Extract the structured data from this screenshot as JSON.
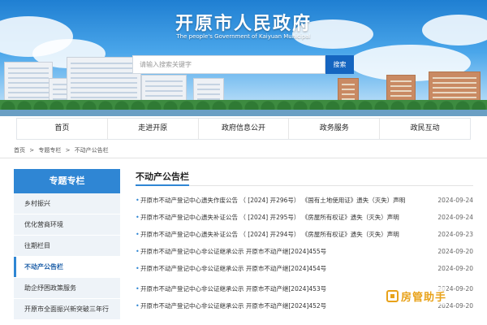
{
  "header": {
    "site_title": "开原市人民政府",
    "site_subtitle": "The people's Government of Kaiyuan Municipal",
    "search_placeholder": "请输入搜索关键字",
    "search_button": "搜索"
  },
  "nav": [
    "首页",
    "走进开原",
    "政府信息公开",
    "政务服务",
    "政民互动"
  ],
  "breadcrumb": [
    "首页",
    ">",
    "专题专栏",
    ">",
    "不动产公告栏"
  ],
  "sidebar": {
    "title": "专题专栏",
    "items": [
      "乡村振兴",
      "优化营商环境",
      "往期栏目",
      "不动产公告栏",
      "助企纾困政策服务",
      "开原市全面振兴新突破三年行"
    ],
    "active_index": 3
  },
  "main": {
    "title": "不动产公告栏",
    "items": [
      {
        "title": "开原市不动产登记中心遗失作废公告  （ [2024] 开296号） 《国有土地使用证》遗失（灭失）声明",
        "date": "2024-09-24"
      },
      {
        "title": "开原市不动产登记中心遗失补证公告  （ [2024] 开295号） 《房屋所有权证》遗失（灭失）声明",
        "date": "2024-09-24"
      },
      {
        "title": "开原市不动产登记中心遗失补证公告  （ [2024] 开294号） 《房屋所有权证》遗失（灭失）声明",
        "date": "2024-09-23"
      },
      {
        "title": "开原市不动产登记中心非公证继承公示          开原市不动产继[2024]455号",
        "date": "2024-09-20"
      },
      {
        "title": "开原市不动产登记中心非公证继承公示          开原市不动产继[2024]454号",
        "date": "2024-09-20"
      },
      {
        "title": "开原市不动产登记中心非公证继承公示          开原市不动产继[2024]453号",
        "date": "2024-09-20"
      },
      {
        "title": "开原市不动产登记中心非公证继承公示          开原市不动产继[2024]452号",
        "date": "2024-09-20"
      }
    ]
  },
  "watermark": "房管助手",
  "colors": {
    "accent": "#2f86d4",
    "search_button": "#1565c0",
    "watermark": "#e8a21a"
  }
}
